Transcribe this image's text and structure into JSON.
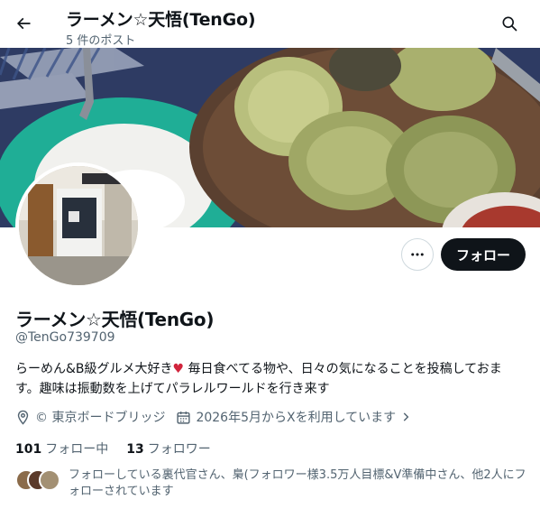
{
  "header": {
    "title": "ラーメン☆天悟(TenGo)",
    "post_count": "5 件のポスト"
  },
  "profile": {
    "name": "ラーメン☆天悟(TenGo)",
    "handle": "@TenGo739709",
    "bio_before_heart": "らーめん&B級グルメ大好き",
    "bio_after_heart": " 毎日食べてる物や、日々の気になることを投稿しておます。趣味は振動数を上げてパラレルワールドを行き来す",
    "location": "© 東京ボードブリッジ",
    "joined": "2026年5月からXを利用しています",
    "following_count": "101",
    "following_label": "フォロー中",
    "followers_count": "13",
    "followers_label": "フォロワー",
    "followed_by_text": "フォローしている裏代官さん、梟(フォロワー様3.5万人目標&V準備中さん、他2人にフォローされています"
  },
  "actions": {
    "follow_label": "フォロー"
  },
  "colors": {
    "accent_black": "#0f1419",
    "secondary_text": "#536471",
    "heart": "#d1243c"
  },
  "icons": [
    "back-arrow-icon",
    "search-icon",
    "more-icon",
    "location-icon",
    "calendar-icon",
    "chevron-right-icon"
  ]
}
